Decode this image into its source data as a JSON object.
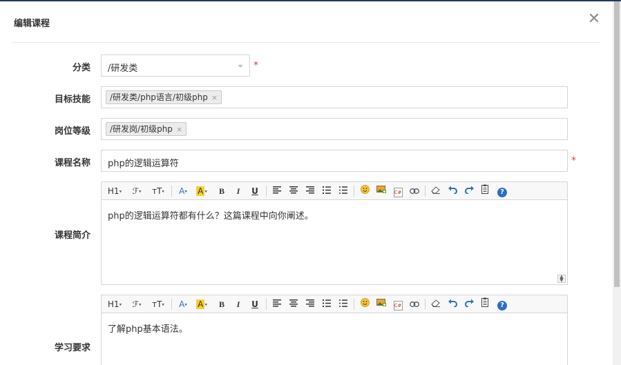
{
  "dialog": {
    "title": "编辑课程",
    "close_symbol": "✕"
  },
  "form": {
    "category": {
      "label": "分类",
      "value": "/研发类",
      "required_mark": "*"
    },
    "target_skill": {
      "label": "目标技能",
      "tags": [
        "/研发类/php语言/初级php"
      ],
      "remove_symbol": "×"
    },
    "position_level": {
      "label": "岗位等级",
      "tags": [
        "/研发岗/初级php"
      ],
      "remove_symbol": "×"
    },
    "course_name": {
      "label": "课程名称",
      "value": "php的逻辑运算符",
      "required_mark": "*"
    },
    "course_intro": {
      "label": "课程简介",
      "content": "php的逻辑运算符都有什么？这篇课程中向你阐述。"
    },
    "study_requirement": {
      "label": "学习要求",
      "content": "了解php基本语法。"
    }
  },
  "toolbar": {
    "heading": "H1",
    "font_family": "ℱ",
    "font_size": "тT",
    "font_color": "A",
    "highlight": "A",
    "bold": "B",
    "italic": "I",
    "underline": "U",
    "code": "C#",
    "help": "?",
    "highlight_color": "#f5d230",
    "accent_color": "#2a6fc9"
  }
}
